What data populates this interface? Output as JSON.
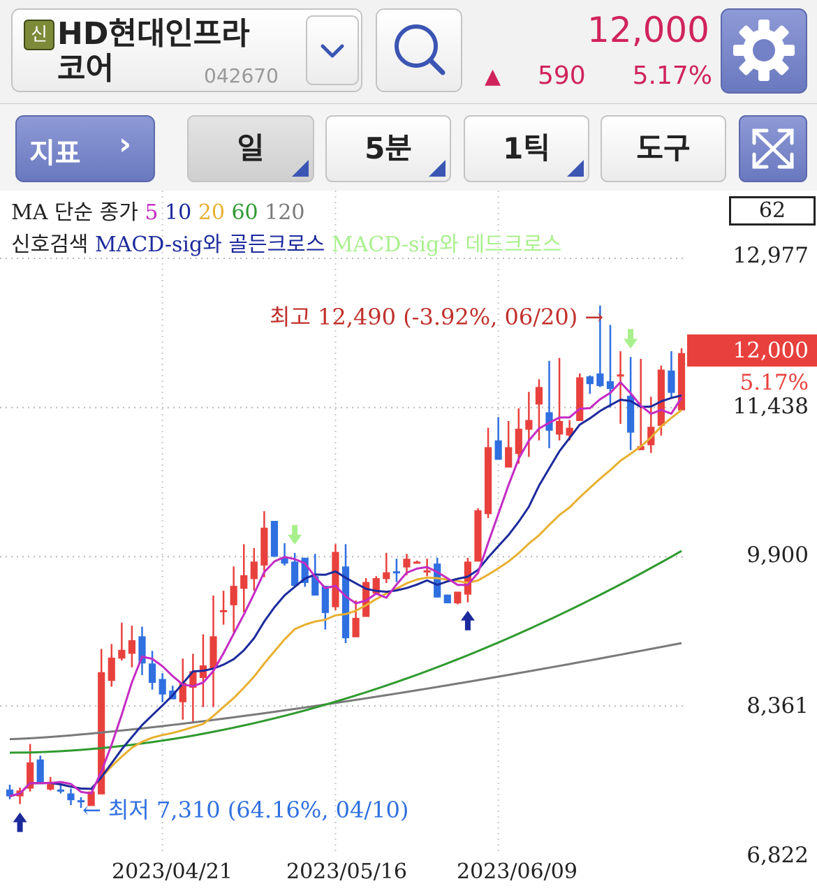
{
  "header": {
    "badge": "신",
    "stock_name": "HD현대인프라코어",
    "stock_code": "042670",
    "price": "12,000",
    "change_arrow": "▲",
    "change": "590",
    "rate": "5.17%",
    "icons": {
      "dropdown": "chevron-down-icon",
      "search": "search-icon",
      "settings": "gear-icon"
    }
  },
  "toolbar": {
    "indicator_label": "지표",
    "indicator_chevron": "›",
    "period_day": "일",
    "period_min": "5분",
    "period_tick": "1틱",
    "tools": "도구",
    "expand_icon": "expand-icon"
  },
  "legend": {
    "ma_prefix": "MA 단순 종가",
    "ma_periods": [
      "5",
      "10",
      "20",
      "60",
      "120"
    ],
    "ma_colors": [
      "#c42bc4",
      "#1c2a9c",
      "#e8b030",
      "#2f9a2f",
      "#7a7a7a"
    ],
    "signal_prefix": "신호검색",
    "signal_golden": "MACD-sig와 골든크로스",
    "signal_dead": "MACD-sig와 데드크로스",
    "golden_color": "#1c2a9c",
    "dead_color": "#a8f08c"
  },
  "chart_data": {
    "type": "candlestick",
    "visible_count": "62",
    "y_ticks": [
      "12,977",
      "11,438",
      "9,900",
      "8,361",
      "6,822"
    ],
    "y_tick_values": [
      12977,
      11438,
      9900,
      8361,
      6822
    ],
    "x_ticks": [
      "2023/04/21",
      "2023/05/16",
      "2023/06/09"
    ],
    "x_tick_index": [
      15,
      32,
      48
    ],
    "current_price": "12,000",
    "current_rate": "5.17%",
    "high_annotation": "최고 12,490 (-3.92%, 06/20) →",
    "low_annotation": "← 최저 7,310 (64.16%, 04/10)",
    "up_color": "#e8413d",
    "down_color": "#2f6fe0",
    "candles": [
      [
        7500,
        7550,
        7400,
        7430
      ],
      [
        7430,
        7520,
        7350,
        7490
      ],
      [
        7510,
        7970,
        7480,
        7780
      ],
      [
        7810,
        7850,
        7570,
        7560
      ],
      [
        7500,
        7630,
        7490,
        7580
      ],
      [
        7500,
        7560,
        7460,
        7480
      ],
      [
        7460,
        7510,
        7340,
        7390
      ],
      [
        7390,
        7420,
        7310,
        7370
      ],
      [
        7330,
        7470,
        7340,
        7480
      ],
      [
        7450,
        8950,
        7620,
        8710
      ],
      [
        8620,
        9000,
        8560,
        8860
      ],
      [
        8850,
        9220,
        8830,
        8940
      ],
      [
        8900,
        9190,
        8760,
        9040
      ],
      [
        9080,
        9180,
        8680,
        8800
      ],
      [
        8800,
        8930,
        8530,
        8600
      ],
      [
        8640,
        8700,
        8400,
        8480
      ],
      [
        8520,
        8570,
        8440,
        8430
      ],
      [
        8400,
        8850,
        8220,
        8600
      ],
      [
        8550,
        8900,
        8200,
        8720
      ],
      [
        8650,
        9100,
        8350,
        8780
      ],
      [
        8750,
        9500,
        8350,
        9080
      ],
      [
        9350,
        9550,
        9200,
        9350
      ],
      [
        9400,
        9800,
        9120,
        9600
      ],
      [
        9570,
        10030,
        9330,
        9710
      ],
      [
        9670,
        9990,
        9550,
        9850
      ],
      [
        9810,
        10370,
        9690,
        10200
      ],
      [
        10270,
        10270,
        9900,
        9900
      ],
      [
        9890,
        10040,
        9810,
        9830
      ],
      [
        9850,
        9940,
        9600,
        9600
      ],
      [
        9890,
        9890,
        9590,
        9630
      ],
      [
        9700,
        9930,
        9500,
        9500
      ],
      [
        9600,
        9600,
        9150,
        9320
      ],
      [
        9380,
        10030,
        9350,
        9950
      ],
      [
        9800,
        10030,
        9010,
        9060
      ],
      [
        9070,
        9450,
        9090,
        9270
      ],
      [
        9280,
        9680,
        9350,
        9640
      ],
      [
        9520,
        9700,
        9550,
        9680
      ],
      [
        9670,
        9940,
        9630,
        9740
      ],
      [
        9750,
        9880,
        9640,
        9740
      ],
      [
        9790,
        9930,
        9710,
        9880
      ],
      [
        9850,
        9860,
        9830,
        9850
      ],
      [
        9760,
        9880,
        9700,
        9760
      ],
      [
        9830,
        9890,
        9480,
        9480
      ],
      [
        9510,
        9510,
        9430,
        9420
      ],
      [
        9420,
        9510,
        9410,
        9540
      ],
      [
        9510,
        9890,
        9430,
        9850
      ],
      [
        9850,
        10400,
        9900,
        10380
      ],
      [
        10340,
        11230,
        10300,
        11030
      ],
      [
        11100,
        11340,
        10900,
        10900
      ],
      [
        10820,
        11300,
        10900,
        11030
      ],
      [
        10960,
        11430,
        10860,
        11220
      ],
      [
        11210,
        11600,
        10930,
        11310
      ],
      [
        11470,
        11730,
        11100,
        11650
      ],
      [
        11390,
        11920,
        11020,
        11200
      ],
      [
        11160,
        11950,
        11100,
        11300
      ],
      [
        11150,
        11310,
        11100,
        11230
      ],
      [
        11300,
        11790,
        11300,
        11750
      ],
      [
        11760,
        11770,
        11580,
        11680
      ],
      [
        11790,
        12490,
        11650,
        11660
      ],
      [
        11710,
        12290,
        11440,
        11630
      ],
      [
        11780,
        12020,
        11270,
        11780
      ],
      [
        11560,
        11960,
        11000,
        11180
      ],
      [
        11000,
        11940,
        11000,
        11040
      ],
      [
        11050,
        11550,
        10970,
        11240
      ],
      [
        11250,
        11870,
        11150,
        11830
      ],
      [
        11820,
        12020,
        11540,
        11590
      ],
      [
        11410,
        12050,
        11720,
        12000
      ]
    ]
  }
}
